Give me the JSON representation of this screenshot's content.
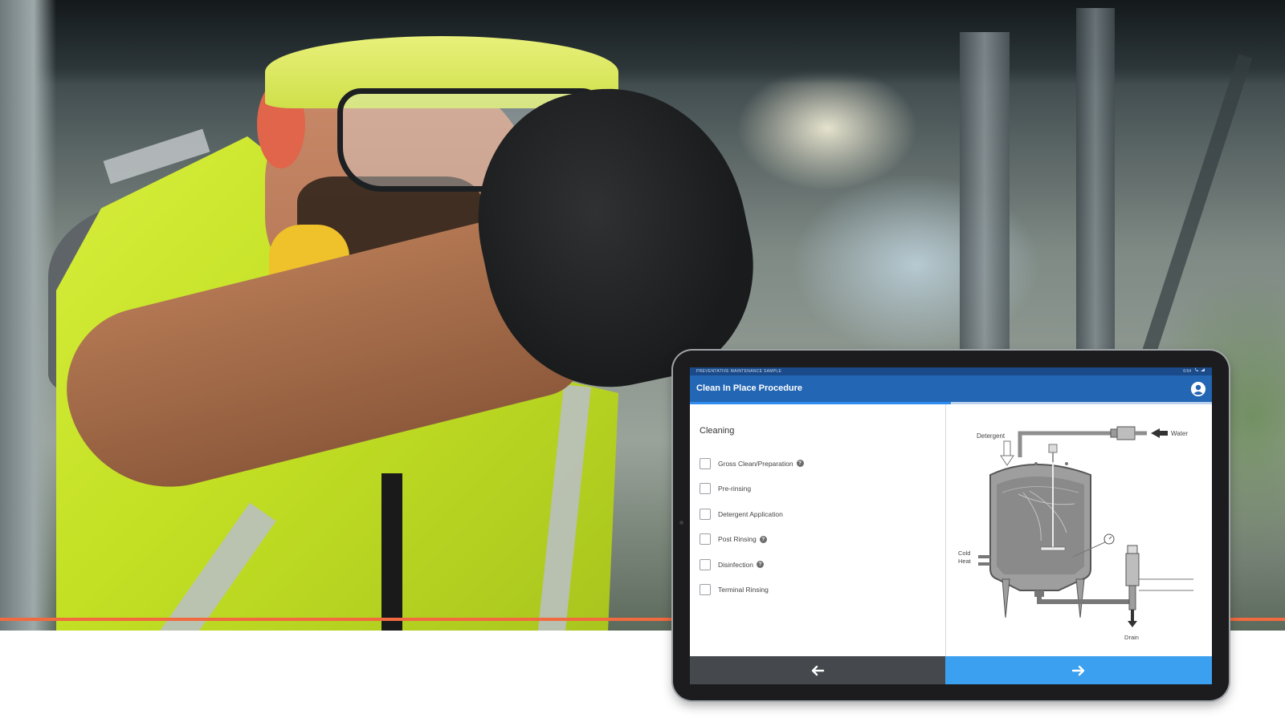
{
  "colors": {
    "accent_rule": "#f26a3f",
    "status_bar": "#1a4a8a",
    "app_bar": "#2366b4",
    "progress_fill": "#2f8cf0",
    "nav_back": "#45494d",
    "nav_next": "#3ba0f0"
  },
  "hero": {
    "image": "worker in hi-vis vest, hard hat and safety glasses reaching up to machinery"
  },
  "tablet": {
    "status_bar": {
      "title": "PREVENTATIVE MAINTENANCE SAMPLE",
      "time": "6:54",
      "icons": [
        "phone-icon",
        "wifi-icon"
      ]
    },
    "app_bar": {
      "title": "Clean In Place Procedure",
      "account_icon": "account-circle-icon"
    },
    "progress": 0.5,
    "section_title": "Cleaning",
    "checklist": [
      {
        "label": "Gross Clean/Preparation",
        "checked": false,
        "help": true
      },
      {
        "label": "Pre-rinsing",
        "checked": false,
        "help": false
      },
      {
        "label": "Detergent Application",
        "checked": false,
        "help": false
      },
      {
        "label": "Post Rinsing",
        "checked": false,
        "help": true
      },
      {
        "label": "Disinfection",
        "checked": false,
        "help": true
      },
      {
        "label": "Terminal Rinsing",
        "checked": false,
        "help": false
      }
    ],
    "help_glyph": "?",
    "diagram": {
      "labels": {
        "detergent": "Detergent",
        "water": "Water",
        "cold": "Cold",
        "heat": "Heat",
        "drain": "Drain"
      }
    },
    "nav": {
      "back_glyph": "🡐",
      "next_glyph": "🡒"
    }
  }
}
